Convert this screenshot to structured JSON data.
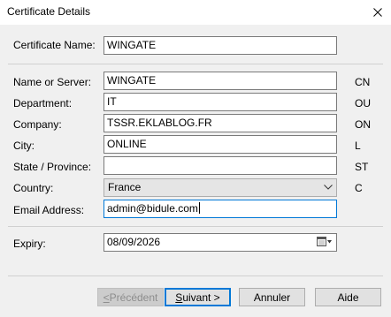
{
  "window": {
    "title": "Certificate Details",
    "close_icon": "close-icon"
  },
  "certificate_name": {
    "label": "Certificate Name:",
    "value": "WINGATE"
  },
  "fields": [
    {
      "label": "Name or Server:",
      "value": "WINGATE",
      "code": "CN"
    },
    {
      "label": "Department:",
      "value": "IT",
      "code": "OU"
    },
    {
      "label": "Company:",
      "value": "TSSR.EKLABLOG.FR",
      "code": "ON"
    },
    {
      "label": "City:",
      "value": "ONLINE",
      "code": "L"
    },
    {
      "label": "State / Province:",
      "value": "",
      "code": "ST"
    }
  ],
  "country": {
    "label": "Country:",
    "value": "France",
    "code": "C"
  },
  "email": {
    "label": "Email Address:",
    "value": "admin@bidule.com"
  },
  "expiry": {
    "label": "Expiry:",
    "value": "08/09/2026",
    "icon": "calendar-dropdown-icon"
  },
  "buttons": {
    "previous": {
      "first": "<",
      "rest": " Précédent"
    },
    "next": {
      "first": "S",
      "rest": "uivant >"
    },
    "cancel": "Annuler",
    "help": "Aide"
  },
  "colors": {
    "focus": "#0078d7",
    "background": "#f0f0f0"
  }
}
